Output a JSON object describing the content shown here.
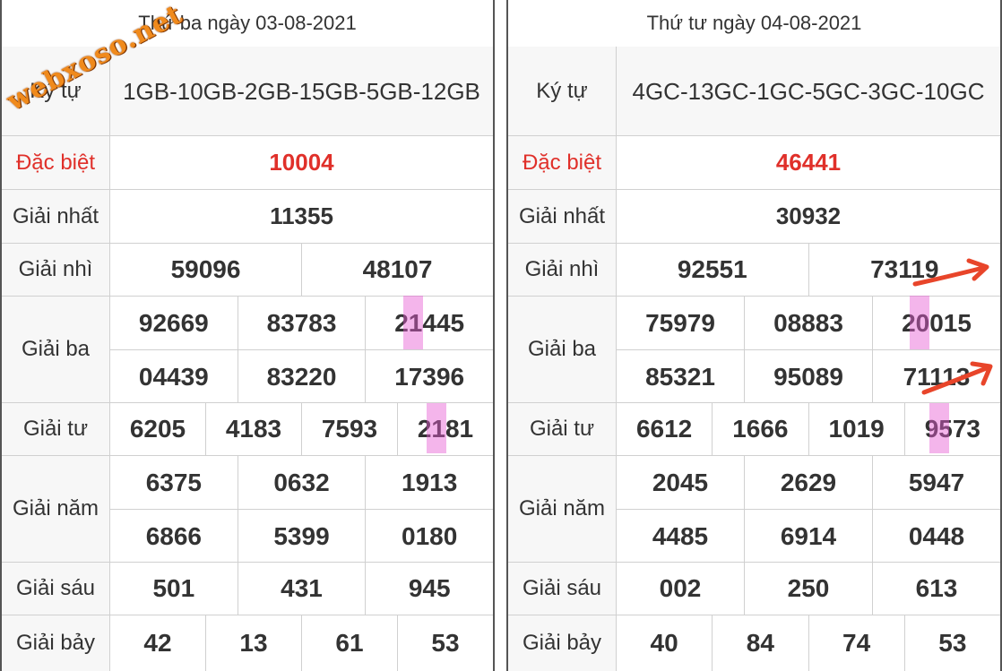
{
  "watermark": "webxoso.net",
  "left": {
    "header": "Thứ ba ngày 03-08-2021",
    "ky_tu": {
      "label": "Ký tự",
      "value": "1GB-10GB-2GB-15GB-5GB-12GB"
    },
    "dac_biet": {
      "label": "Đặc biệt",
      "value": "10004"
    },
    "giai_nhat": {
      "label": "Giải nhất",
      "value": "11355"
    },
    "giai_nhi": {
      "label": "Giải nhì",
      "values": [
        "59096",
        "48107"
      ]
    },
    "giai_ba": {
      "label": "Giải ba",
      "values": [
        "92669",
        "83783",
        "21445",
        "04439",
        "83220",
        "17396"
      ]
    },
    "giai_tu": {
      "label": "Giải tư",
      "values": [
        "6205",
        "4183",
        "7593",
        "2181"
      ]
    },
    "giai_nam": {
      "label": "Giải năm",
      "values": [
        "6375",
        "0632",
        "1913",
        "6866",
        "5399",
        "0180"
      ]
    },
    "giai_sau": {
      "label": "Giải sáu",
      "values": [
        "501",
        "431",
        "945"
      ]
    },
    "giai_bay": {
      "label": "Giải bảy",
      "values": [
        "42",
        "13",
        "61",
        "53"
      ]
    }
  },
  "right": {
    "header": "Thứ tư ngày 04-08-2021",
    "ky_tu": {
      "label": "Ký tự",
      "value": "4GC-13GC-1GC-5GC-3GC-10GC"
    },
    "dac_biet": {
      "label": "Đặc biệt",
      "value": "46441"
    },
    "giai_nhat": {
      "label": "Giải nhất",
      "value": "30932"
    },
    "giai_nhi": {
      "label": "Giải nhì",
      "values": [
        "92551",
        "73119"
      ]
    },
    "giai_ba": {
      "label": "Giải ba",
      "values": [
        "75979",
        "08883",
        "20015",
        "85321",
        "95089",
        "71113"
      ]
    },
    "giai_tu": {
      "label": "Giải tư",
      "values": [
        "6612",
        "1666",
        "1019",
        "9573"
      ]
    },
    "giai_nam": {
      "label": "Giải năm",
      "values": [
        "2045",
        "2629",
        "5947",
        "4485",
        "6914",
        "0448"
      ]
    },
    "giai_sau": {
      "label": "Giải sáu",
      "values": [
        "002",
        "250",
        "613"
      ]
    },
    "giai_bay": {
      "label": "Giải bảy",
      "values": [
        "40",
        "84",
        "74",
        "53"
      ]
    }
  },
  "colors": {
    "red": "#e0302a",
    "highlight": "#e65ad2",
    "arrow": "#e8452a",
    "watermark": "#f08a1c"
  }
}
